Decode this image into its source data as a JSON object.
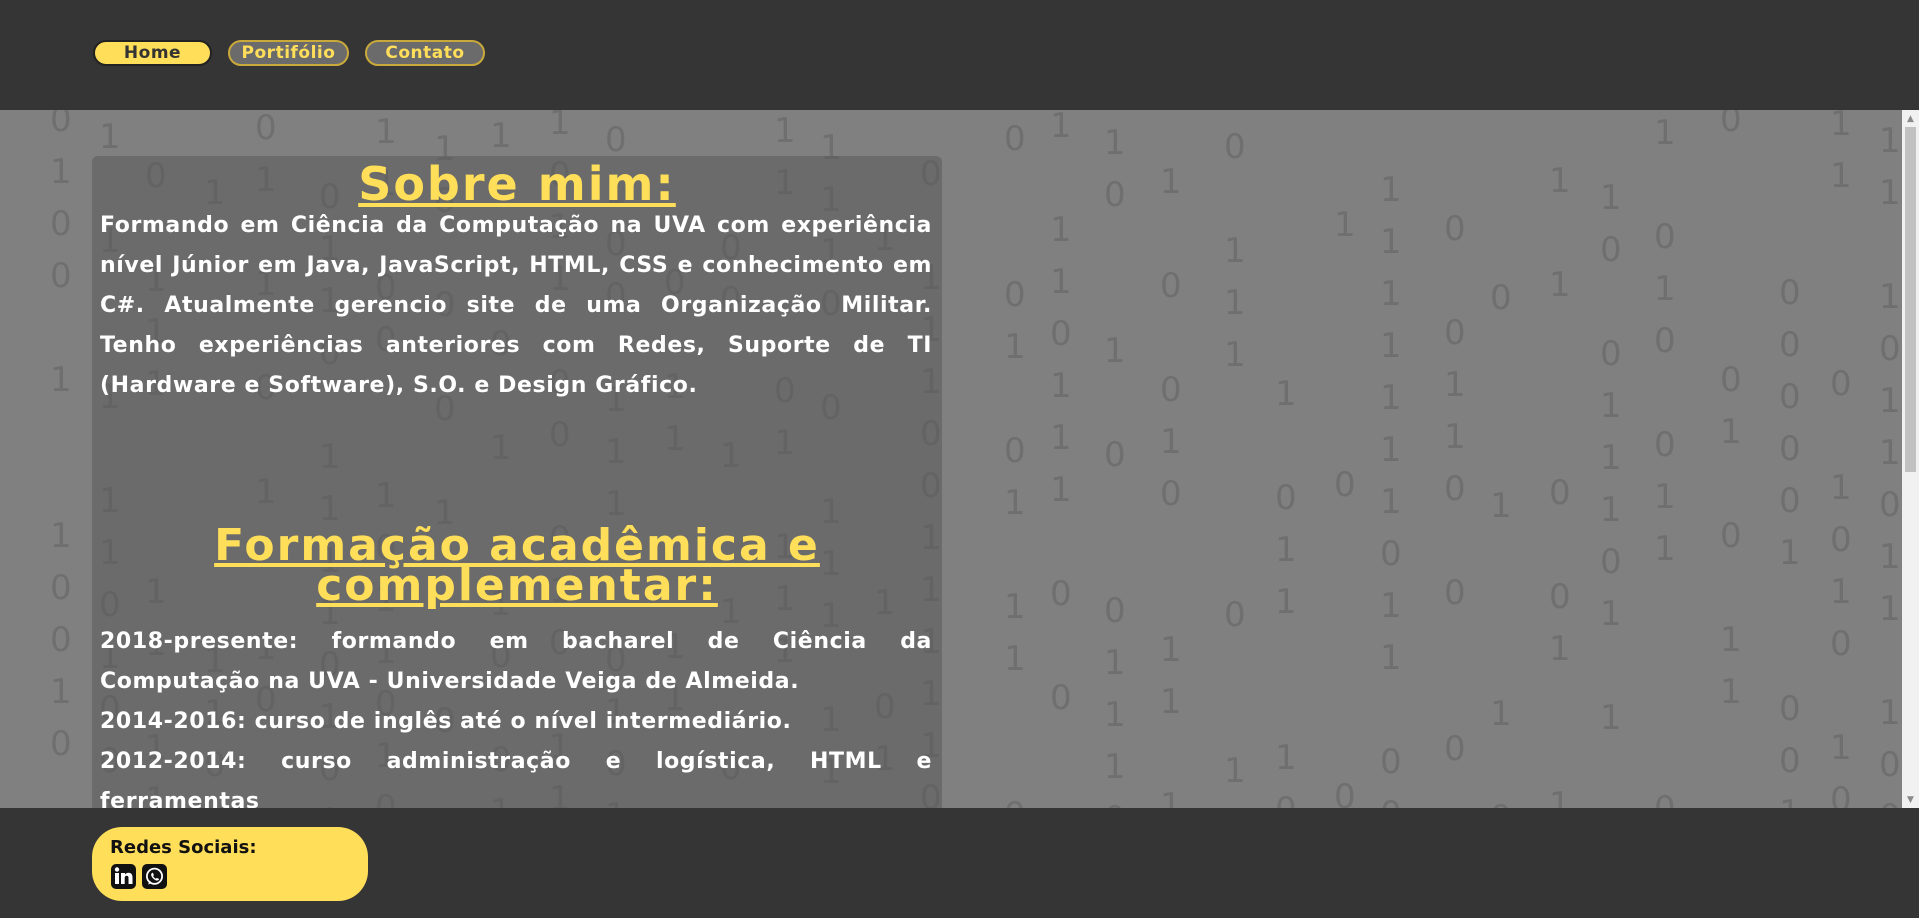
{
  "nav": {
    "items": [
      {
        "label": "Home",
        "active": true
      },
      {
        "label": "Portifólio",
        "active": false
      },
      {
        "label": "Contato",
        "active": false
      }
    ]
  },
  "about": {
    "title": "Sobre mim:",
    "text": "Formando em Ciência da Computação na UVA com experiência nível Júnior em Java, JavaScript, HTML, CSS e conhecimento em C#. Atualmente gerencio site de uma Organização Militar. Tenho experiências anteriores com Redes, Suporte de TI (Hardware e Software), S.O. e Design Gráfico."
  },
  "education": {
    "title": "Formação acadêmica e complementar:",
    "lines": [
      "2018-presente: formando em bacharel de Ciência da Computação na UVA - Universidade Veiga de Almeida.",
      "2014-2016: curso de inglês até o nível intermediário.",
      "2012-2014: curso administração e logística, HTML e ferramentas"
    ]
  },
  "footer": {
    "social_title": "Redes Sociais:",
    "icons": [
      "linkedin-icon",
      "whatsapp-icon"
    ]
  },
  "colors": {
    "accent": "#ffde59",
    "header_bg": "#353535",
    "main_bg": "#808080"
  }
}
